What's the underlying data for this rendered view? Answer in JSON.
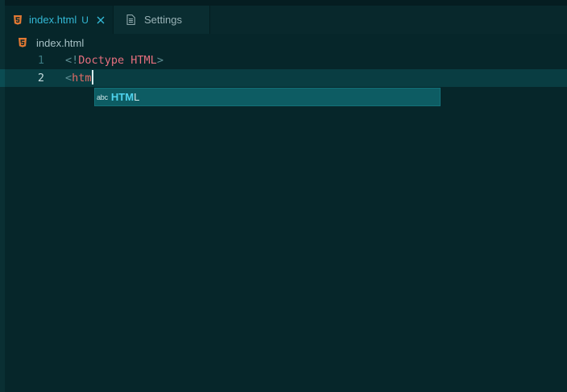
{
  "tabs": [
    {
      "label": "index.html",
      "status": "U",
      "active": true,
      "icon": "html5-icon"
    },
    {
      "label": "Settings",
      "active": false,
      "icon": "file-icon"
    }
  ],
  "breadcrumb": {
    "file": "index.html"
  },
  "editor": {
    "lines": [
      {
        "number": "1",
        "punct_open": "<!",
        "doctype": "Doctype HTML",
        "punct_close": ">"
      },
      {
        "number": "2",
        "punct_open": "<",
        "tag": "htm"
      }
    ]
  },
  "suggestion": {
    "kind": "abc",
    "match": "HTM",
    "rest": "L"
  },
  "colors": {
    "background": "#06262a",
    "accent": "#33b9d6",
    "html5_orange": "#e37933",
    "suggest_bg": "#0d5c63"
  }
}
